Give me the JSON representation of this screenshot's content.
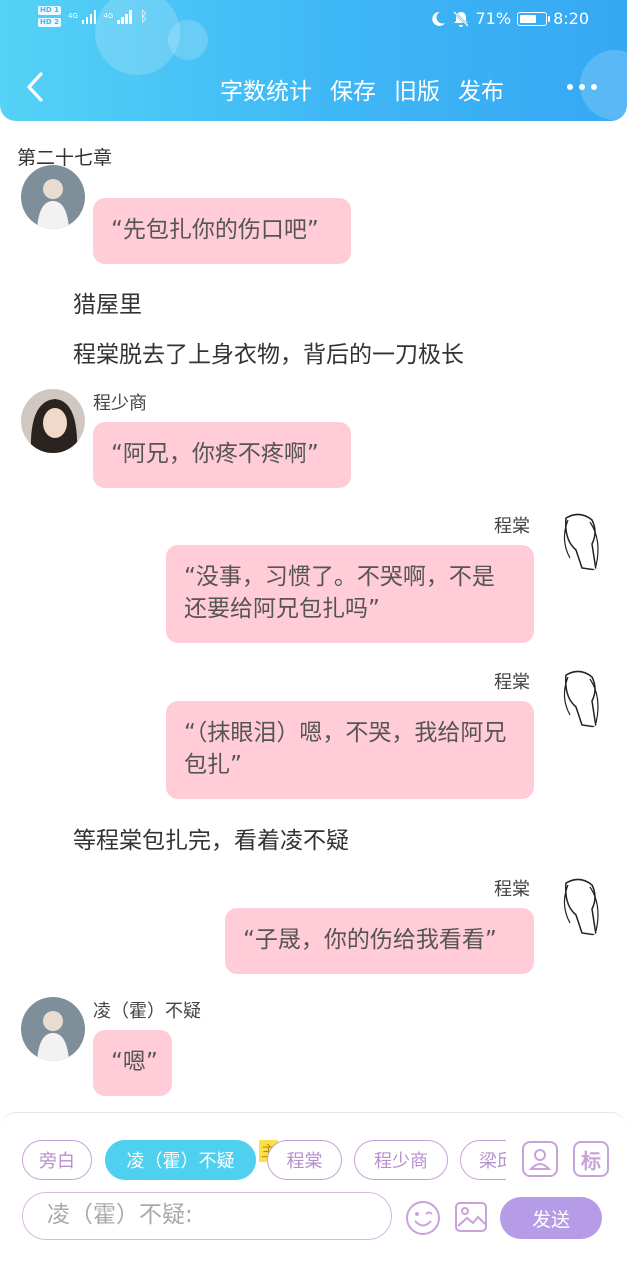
{
  "status_bar": {
    "hd1": "HD 1",
    "hd2": "HD 2",
    "net1": "4G",
    "net2": "4G",
    "battery": "71%",
    "battery_level": 0.71,
    "time": "8:20"
  },
  "header": {
    "actions": [
      "字数统计",
      "保存",
      "旧版",
      "发布"
    ]
  },
  "chapter_title": "第二十七章",
  "messages": [
    {
      "type": "left",
      "speaker": "",
      "text": "“先包扎你的伤口吧”"
    },
    {
      "type": "narration",
      "text": "猎屋里"
    },
    {
      "type": "narration",
      "text": "程棠脱去了上身衣物，背后的一刀极长"
    },
    {
      "type": "left",
      "speaker": "程少商",
      "text": "“阿兄，你疼不疼啊”"
    },
    {
      "type": "right",
      "speaker": "程棠",
      "text": "“没事，习惯了。不哭啊，不是还要给阿兄包扎吗”"
    },
    {
      "type": "right",
      "speaker": "程棠",
      "text": "“（抹眼泪）嗯，不哭，我给阿兄包扎”"
    },
    {
      "type": "narration",
      "text": "等程棠包扎完，看着凌不疑"
    },
    {
      "type": "right",
      "speaker": "程棠",
      "text": "“子晟，你的伤给我看看”"
    },
    {
      "type": "left",
      "speaker": "凌（霍）不疑",
      "text": "“嗯”"
    }
  ],
  "roles": [
    "旁白",
    "凌（霍）不疑",
    "程棠",
    "程少商",
    "梁邱"
  ],
  "main_tag": "主",
  "mark_icon_label": "标",
  "input": {
    "value": "凌（霍）不疑:"
  },
  "send_label": "发送",
  "colors": {
    "header_start": "#55d2f6",
    "header_end": "#35a8f3",
    "bubble": "#ffccd8",
    "chip_border": "#c9a2da",
    "chip_active": "#4fd0ef",
    "send": "#b69be6"
  },
  "icons": [
    "back-arrow-icon",
    "more-icon",
    "moon-icon",
    "mute-bell-icon",
    "bluetooth-icon",
    "battery-icon",
    "person-icon",
    "emoji-icon",
    "picture-icon"
  ]
}
